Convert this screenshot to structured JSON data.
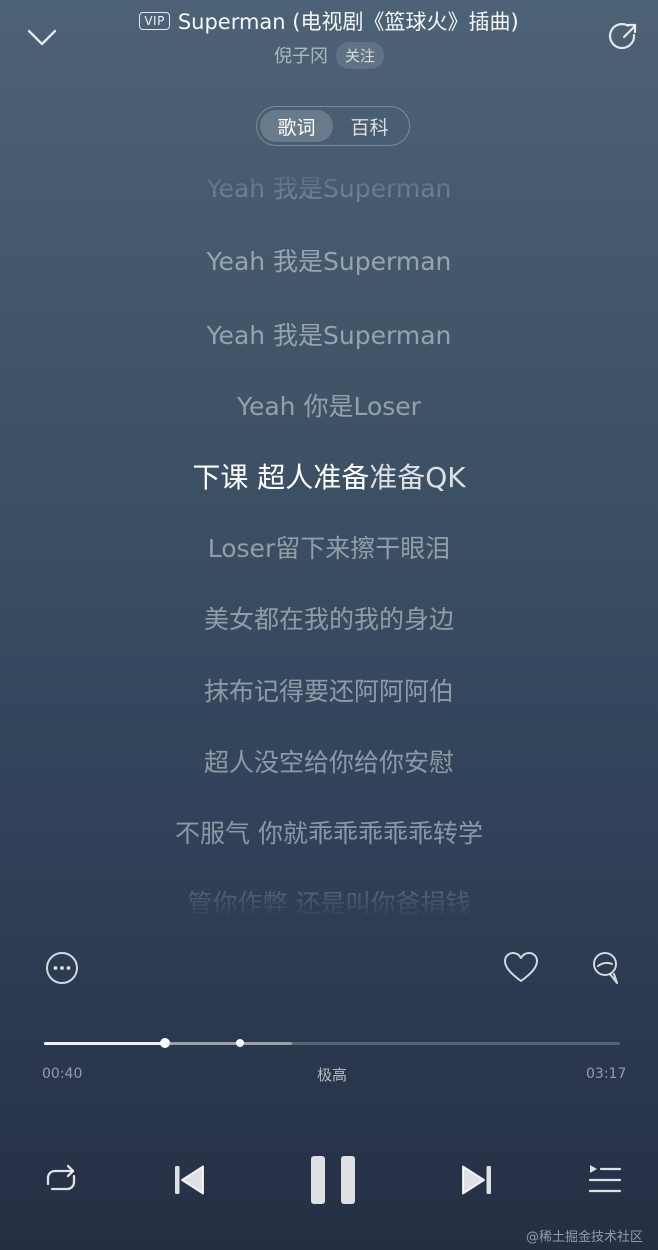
{
  "header": {
    "vip_badge": "VIP",
    "song_title": "Superman (电视剧《篮球火》插曲)",
    "artist": "倪子冈",
    "follow_label": "关注"
  },
  "tabs": [
    {
      "label": "歌词",
      "active": true
    },
    {
      "label": "百科",
      "active": false
    }
  ],
  "lyrics": {
    "lines": [
      "Yeah 我是Superman",
      "Yeah 我是Superman",
      "Yeah 我是Superman",
      "Yeah 你是Loser",
      "下课 超人准备准备QK",
      "Loser留下来擦干眼泪",
      "美女都在我的我的身边",
      "抹布记得要还阿阿阿伯",
      "超人没空给你给你安慰",
      "不服气 你就乖乖乖乖乖转学",
      "管你作弊 还是叫你爸捐钱"
    ],
    "current_index": 4,
    "current_sung_part": "下课 超人准备",
    "current_unsung_part": "准备QK"
  },
  "player": {
    "elapsed": "00:40",
    "total": "03:17",
    "quality": "极高",
    "progress": 0.21,
    "buffered": 0.43
  },
  "watermark": "@稀土掘金技术社区",
  "icons": {
    "collapse": "chevron-down-icon",
    "share": "share-icon",
    "more": "more-icon",
    "like": "heart-icon",
    "comment": "comment-icon",
    "repeat": "repeat-icon",
    "prev": "previous-icon",
    "pause": "pause-icon",
    "next": "next-icon",
    "playlist": "playlist-icon"
  }
}
